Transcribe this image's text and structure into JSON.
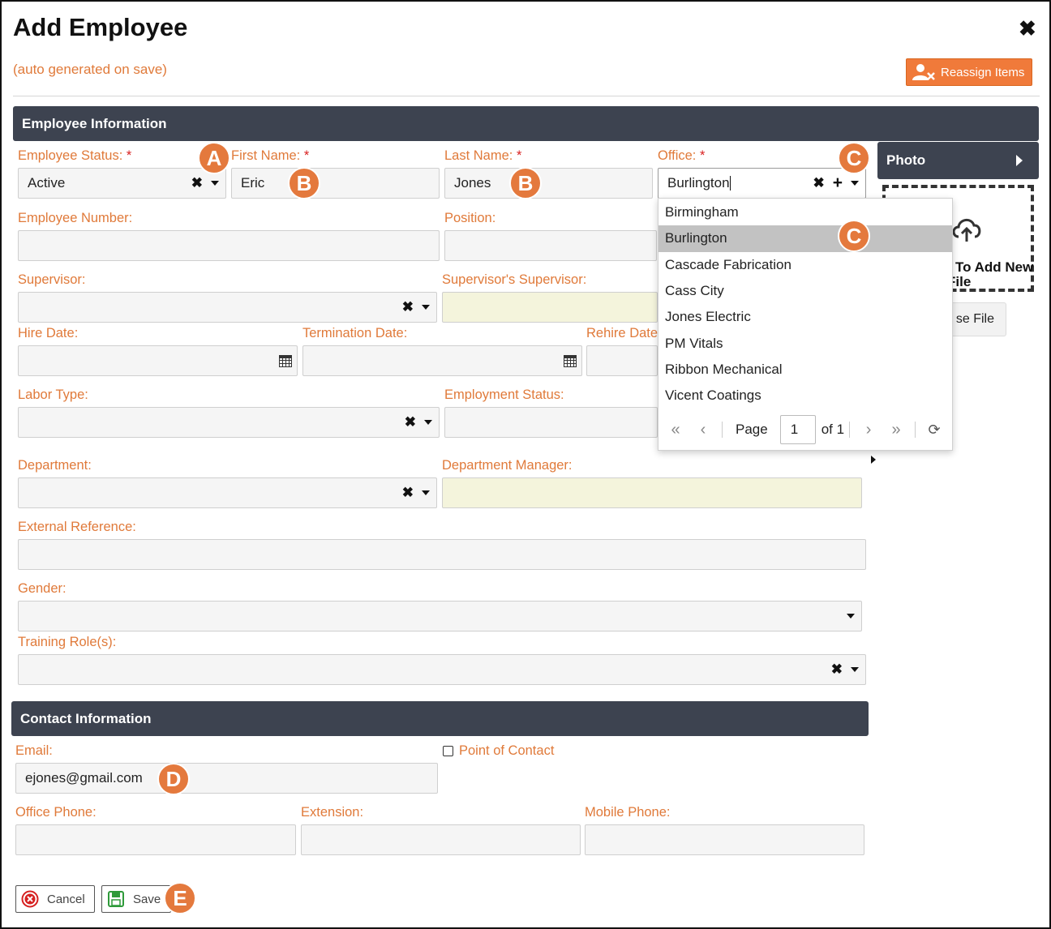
{
  "dialog": {
    "title": "Add Employee",
    "autogen_note": "(auto generated on save)",
    "reassign_label": "Reassign Items"
  },
  "sections": {
    "employee_info": "Employee Information",
    "contact_info": "Contact Information",
    "photo": "Photo"
  },
  "labels": {
    "employee_status": "Employee Status:",
    "first_name": "First Name:",
    "last_name": "Last Name:",
    "office": "Office:",
    "employee_number": "Employee Number:",
    "position": "Position:",
    "supervisor": "Supervisor:",
    "supervisors_supervisor": "Supervisor's Supervisor:",
    "hire_date": "Hire Date:",
    "termination_date": "Termination Date:",
    "rehire_date": "Rehire Date",
    "labor_type": "Labor Type:",
    "employment_status": "Employment Status:",
    "department": "Department:",
    "department_manager": "Department Manager:",
    "external_reference": "External Reference:",
    "gender": "Gender:",
    "training_roles": "Training Role(s):",
    "email": "Email:",
    "point_of_contact": "Point of Contact",
    "office_phone": "Office Phone:",
    "extension": "Extension:",
    "mobile_phone": "Mobile Phone:"
  },
  "required_mark": "*",
  "values": {
    "employee_status": "Active",
    "first_name": "Eric",
    "last_name": "Jones",
    "office": "Burlington",
    "email": "ejones@gmail.com"
  },
  "photo": {
    "dropzone_line1": "To Add New",
    "dropzone_line2": "File",
    "choose_file": "se File"
  },
  "office_dropdown": {
    "options": [
      "Birmingham",
      "Burlington",
      "Cascade Fabrication",
      "Cass City",
      "Jones Electric",
      "PM Vitals",
      "Ribbon Mechanical",
      "Vicent Coatings"
    ],
    "selected": "Burlington",
    "pager": {
      "page_label": "Page",
      "page_value": "1",
      "of_label": "of 1"
    }
  },
  "buttons": {
    "cancel": "Cancel",
    "save": "Save"
  },
  "callouts": {
    "a": "A",
    "b": "B",
    "c": "C",
    "d": "D",
    "e": "E"
  },
  "colors": {
    "accent": "#e07a3a",
    "callout": "#e4793d",
    "section_bar": "#3d4350",
    "required": "#d92020",
    "readonly_field": "#f4f4dc"
  }
}
